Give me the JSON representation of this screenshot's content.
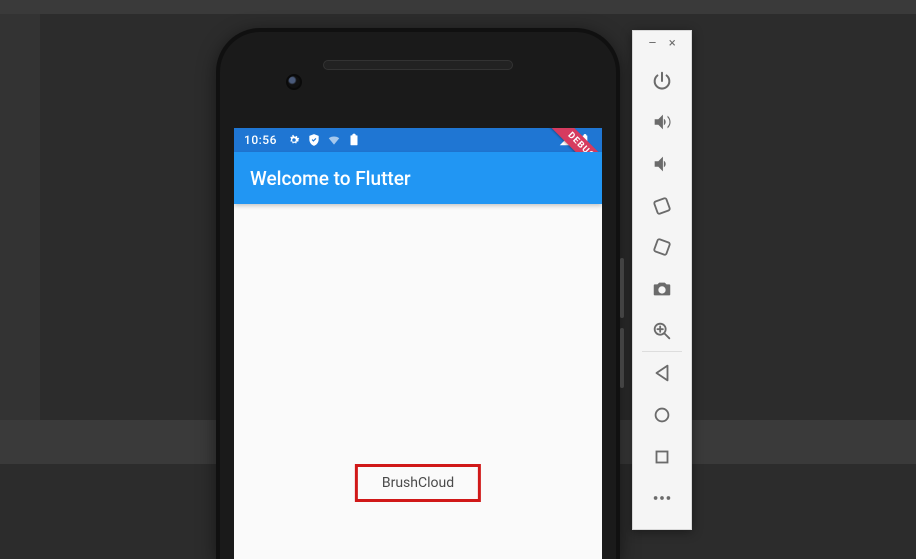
{
  "status": {
    "time": "10:56",
    "left_icons": [
      "gear-icon",
      "shield-icon",
      "wifi-icon",
      "clipboard-icon"
    ],
    "right_icons": [
      "signal-icon",
      "battery-icon"
    ]
  },
  "app": {
    "title": "Welcome to Flutter",
    "body_text": "BrushCloud",
    "debug_banner": "DEBUG"
  },
  "emulator_toolbar": {
    "window_buttons": {
      "minimize": "–",
      "close": "×"
    },
    "buttons": [
      {
        "name": "power-icon",
        "label": "Power"
      },
      {
        "name": "volume-up-icon",
        "label": "Volume up"
      },
      {
        "name": "volume-down-icon",
        "label": "Volume down"
      },
      {
        "name": "rotate-left-icon",
        "label": "Rotate left"
      },
      {
        "name": "rotate-right-icon",
        "label": "Rotate right"
      },
      {
        "name": "camera-icon",
        "label": "Take screenshot"
      },
      {
        "name": "zoom-in-icon",
        "label": "Zoom"
      },
      {
        "name": "back-icon",
        "label": "Back"
      },
      {
        "name": "home-icon",
        "label": "Home"
      },
      {
        "name": "overview-icon",
        "label": "Overview"
      },
      {
        "name": "more-icon",
        "label": "More"
      }
    ]
  }
}
